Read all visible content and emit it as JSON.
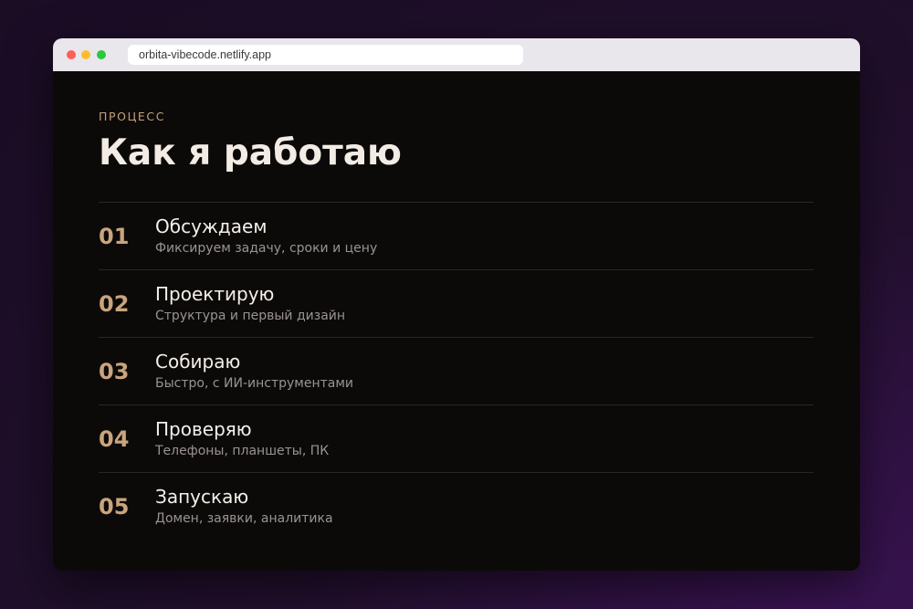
{
  "browser": {
    "url": "orbita-vibecode.netlify.app"
  },
  "section": {
    "eyebrow": "ПРОЦЕСС",
    "title": "Как я работаю"
  },
  "steps": [
    {
      "num": "01",
      "title": "Обсуждаем",
      "desc": "Фиксируем задачу, сроки и цену"
    },
    {
      "num": "02",
      "title": "Проектирую",
      "desc": "Структура и первый дизайн"
    },
    {
      "num": "03",
      "title": "Собираю",
      "desc": "Быстро, с ИИ-инструментами"
    },
    {
      "num": "04",
      "title": "Проверяю",
      "desc": "Телефоны, планшеты, ПК"
    },
    {
      "num": "05",
      "title": "Запускаю",
      "desc": "Домен, заявки, аналитика"
    }
  ],
  "colors": {
    "accent": "#c9a47c",
    "page_background": "#0c0a09",
    "backdrop": "#2a1238"
  }
}
